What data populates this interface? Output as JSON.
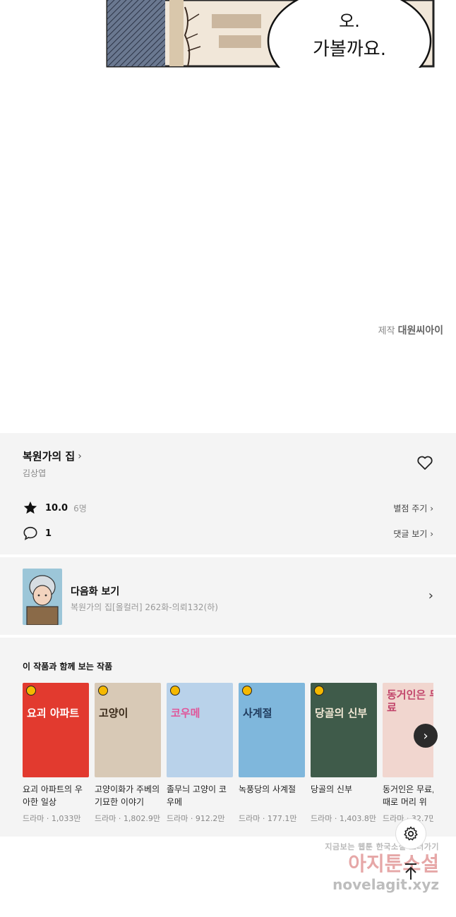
{
  "comic": {
    "bubble_text": "오.\n가볼까요."
  },
  "credit": {
    "label": "제작",
    "studio": "대원씨아이"
  },
  "work": {
    "title": "복원가의 집",
    "author": "김상엽"
  },
  "rating": {
    "score": "10.0",
    "count": "6명",
    "action": "별점 주기"
  },
  "comments": {
    "count": "1",
    "action": "댓글 보기"
  },
  "next_episode": {
    "label": "다음화 보기",
    "subtitle": "복원가의 집[올컬러] 262화-의뢰132(하)"
  },
  "recommendations": {
    "heading": "이 작품과 함께 보는 작품",
    "items": [
      {
        "title": "요괴 아파트의 우아한 일상",
        "genre": "드라마",
        "views": "1,033만",
        "cover_text": "요괴 아파트",
        "bg": "#e23a2f"
      },
      {
        "title": "고양이화가 주베의 기묘한 이야기",
        "genre": "드라마",
        "views": "1,802.9만",
        "cover_text": "고양이",
        "bg": "#d8c9b6"
      },
      {
        "title": "졸무늬 고양이 코우메",
        "genre": "드라마",
        "views": "912.2만",
        "cover_text": "코우메",
        "bg": "#b9d2ea"
      },
      {
        "title": "녹풍당의 사계절",
        "genre": "드라마",
        "views": "177.1만",
        "cover_text": "사계절",
        "bg": "#7fb7dc"
      },
      {
        "title": "당골의 신부",
        "genre": "드라마",
        "views": "1,403.8만",
        "cover_text": "당골의 신부",
        "bg": "#3f5b4a"
      },
      {
        "title": "동거인은 무료, 때때로 머리 위",
        "genre": "드라마",
        "views": "32.7만",
        "cover_text": "동거인은 무료",
        "bg": "#f1d6cf"
      }
    ]
  },
  "watermark": {
    "line1": "지금보는 웹툰 한국소설 보러가기",
    "line2": "아지툰소설",
    "line3": "novelagit.xyz"
  },
  "colors": {
    "section_bg": "#f4f4f4",
    "accent_clock": "#f5b800"
  }
}
